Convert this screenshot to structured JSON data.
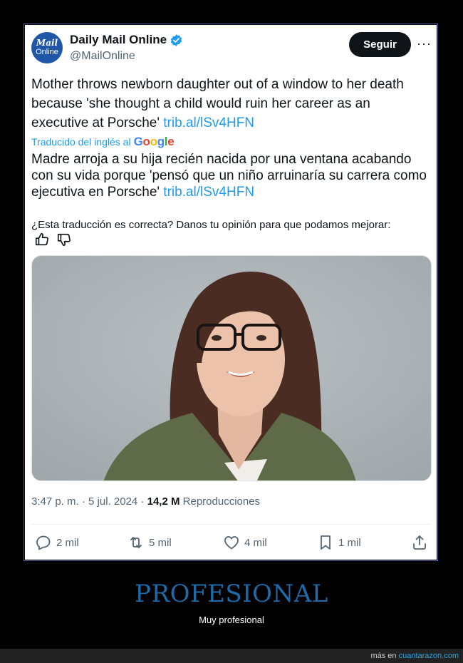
{
  "tweet": {
    "account": {
      "avatar_line1": "Mail",
      "avatar_line2": "Online",
      "name": "Daily Mail Online",
      "handle": "@MailOnline",
      "verified_icon": "verified-badge-icon"
    },
    "follow_label": "Seguir",
    "more_label": "···",
    "original_text": "Mother throws newborn daughter out of a window to her death because 'she thought a child would ruin her career as an executive at Porsche'",
    "original_link": "trib.al/lSv4HFN",
    "translated_label": "Traducido del inglés al",
    "google_letters": [
      "G",
      "o",
      "o",
      "g",
      "l",
      "e"
    ],
    "translated_text": "Madre arroja a su hija recién nacida por una ventana acabando con su vida porque 'pensó que un niño arruinaría su carrera como ejecutiva en Porsche'",
    "translated_link": "trib.al/lSv4HFN",
    "feedback_question": "¿Esta traducción es correcta? Danos tu opinión para que podamos mejorar:",
    "meta": {
      "time": "3:47 p. m.",
      "sep1": " · ",
      "date": "5 jul. 2024",
      "sep2": " · ",
      "views": "14,2 M",
      "views_label": " Reproducciones"
    },
    "actions": {
      "replies": "2 mil",
      "retweets": "5 mil",
      "likes": "4 mil",
      "bookmarks": "1 mil"
    }
  },
  "caption": {
    "title": "PROFESIONAL",
    "subtitle": "Muy profesional"
  },
  "footer": {
    "prefix": "más en ",
    "site": "cuantarazon.com"
  },
  "colors": {
    "link": "#1d9bf0",
    "caption_title": "#1f6aa8",
    "follow_bg": "#0f1419"
  }
}
